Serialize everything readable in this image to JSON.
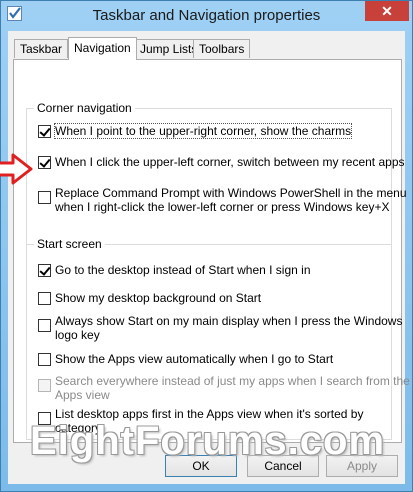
{
  "window": {
    "title": "Taskbar and Navigation properties",
    "close_label": "✕"
  },
  "tabs": [
    {
      "label": "Taskbar",
      "active": false
    },
    {
      "label": "Navigation",
      "active": true
    },
    {
      "label": "Jump Lists",
      "active": false
    },
    {
      "label": "Toolbars",
      "active": false
    }
  ],
  "corner_navigation": {
    "title": "Corner navigation",
    "options": [
      {
        "label": "When I point to the upper-right corner, show the charms",
        "checked": true,
        "disabled": false
      },
      {
        "label": "When I click the upper-left corner, switch between my recent apps",
        "checked": true,
        "disabled": false
      },
      {
        "label_line1": "Replace Command Prompt with Windows PowerShell in the menu",
        "label_line2": "when I right-click the lower-left corner or press Windows key+X",
        "checked": false,
        "disabled": false
      }
    ]
  },
  "start_screen": {
    "title": "Start screen",
    "options": [
      {
        "label": "Go to the desktop instead of Start when I sign in",
        "checked": true,
        "disabled": false
      },
      {
        "label": "Show my desktop background on Start",
        "checked": false,
        "disabled": false
      },
      {
        "label_line1": "Always show Start on my main display when I press the Windows",
        "label_line2": "logo key",
        "checked": false,
        "disabled": false
      },
      {
        "label": "Show the Apps view automatically when I go to Start",
        "checked": false,
        "disabled": false
      },
      {
        "label_line1": "Search everywhere instead of just my apps when I search from the",
        "label_line2": "Apps view",
        "checked": false,
        "disabled": true
      },
      {
        "label_line1": "List desktop apps first in the Apps view when it's sorted by",
        "label_line2": "category",
        "checked": false,
        "disabled": false
      }
    ]
  },
  "watermark": "EightForums.com",
  "buttons": {
    "ok": "OK",
    "cancel": "Cancel",
    "apply": "Apply",
    "apply_disabled": true
  },
  "icons": {
    "app": "taskbar-properties-icon",
    "annotation": "red-arrow-icon"
  },
  "colors": {
    "title_bar": "#7cbbe9",
    "close_button": "#c7403a",
    "annotation_arrow": "#e02020"
  }
}
